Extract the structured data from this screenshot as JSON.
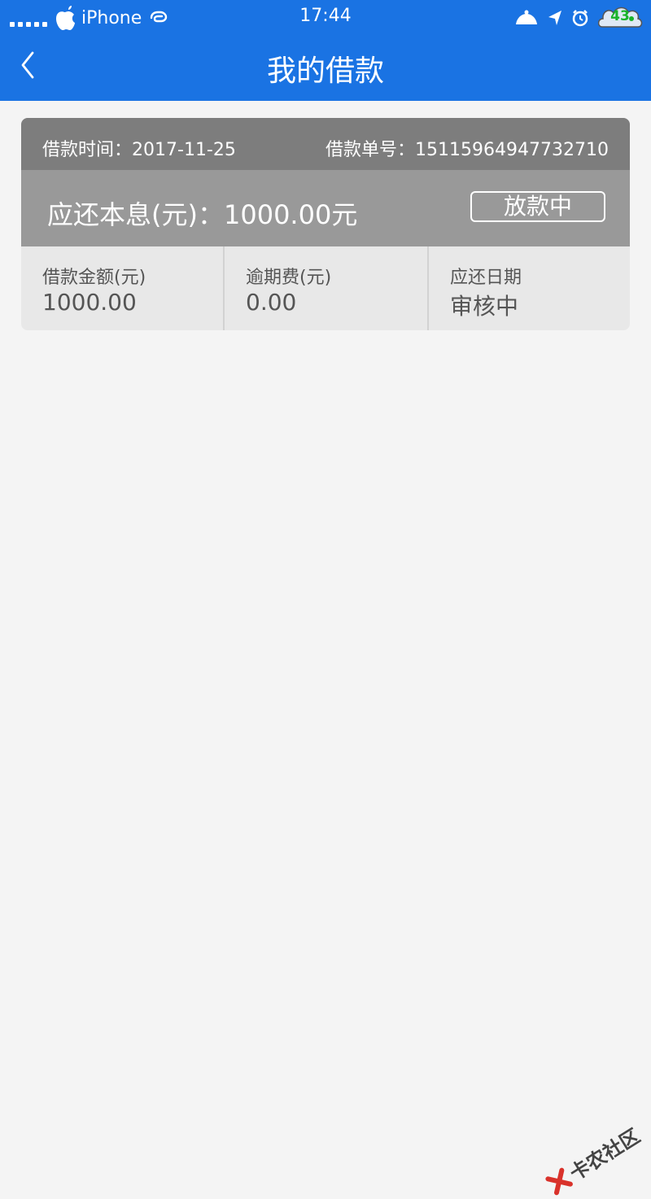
{
  "status_bar": {
    "carrier": "iPhone",
    "time": "17:44",
    "battery": "43"
  },
  "nav": {
    "title": "我的借款"
  },
  "loan": {
    "time_label": "借款时间：",
    "time_value": "2017-11-25",
    "number_label": "借款单号：",
    "number_value": "15115964947732710",
    "due_label": "应还本息(元)：",
    "due_value": "1000.00元",
    "status": "放款中",
    "details": [
      {
        "label": "借款金额(元)",
        "value": "1000.00"
      },
      {
        "label": "逾期费(元)",
        "value": "0.00"
      },
      {
        "label": "应还日期",
        "value": "审核中"
      }
    ]
  },
  "watermark": {
    "text": "卡农社区"
  },
  "colors": {
    "header_blue": "#1a73e3",
    "card_top_gray": "#7d7d7d",
    "card_mid_gray": "#999999",
    "card_bottom_gray": "#e8e8e8",
    "page_bg": "#f4f4f4"
  }
}
